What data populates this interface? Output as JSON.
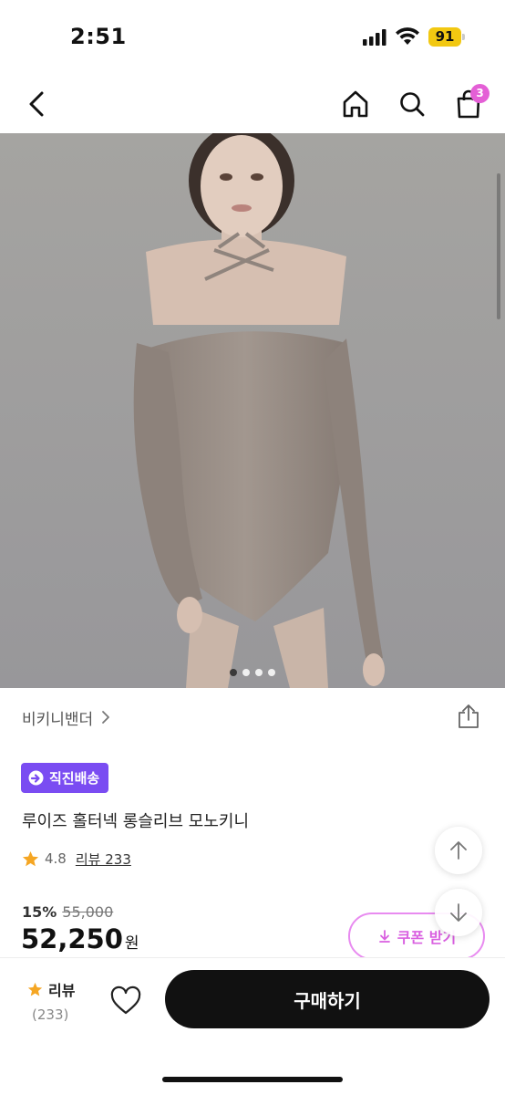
{
  "status_bar": {
    "time": "2:51",
    "battery": "91",
    "battery_color": "#f2c811"
  },
  "nav": {
    "back_icon": "chevron-left-icon",
    "home_icon": "home-icon",
    "search_icon": "search-icon",
    "cart_icon": "shopping-bag-icon",
    "cart_count": "3",
    "badge_color": "#e45fd6"
  },
  "carousel": {
    "image_description_icon": "product-photo",
    "pages": 4,
    "current_page": 1
  },
  "product": {
    "brand": "비키니밴더",
    "badge": "직진배송",
    "badge_color": "#7a4cf2",
    "title": "루이즈 홀터넥 롱슬리브 모노키니",
    "rating": "4.8",
    "review_label": "리뷰 233",
    "discount_rate": "15%",
    "original_price": "55,000",
    "sale_price": "52,250",
    "price_unit": "원"
  },
  "coupon": {
    "label": "쿠폰 받기",
    "accent_color": "#d95fe0"
  },
  "bottom_bar": {
    "review_label": "리뷰",
    "review_count": "(233)",
    "buy_label": "구매하기"
  }
}
